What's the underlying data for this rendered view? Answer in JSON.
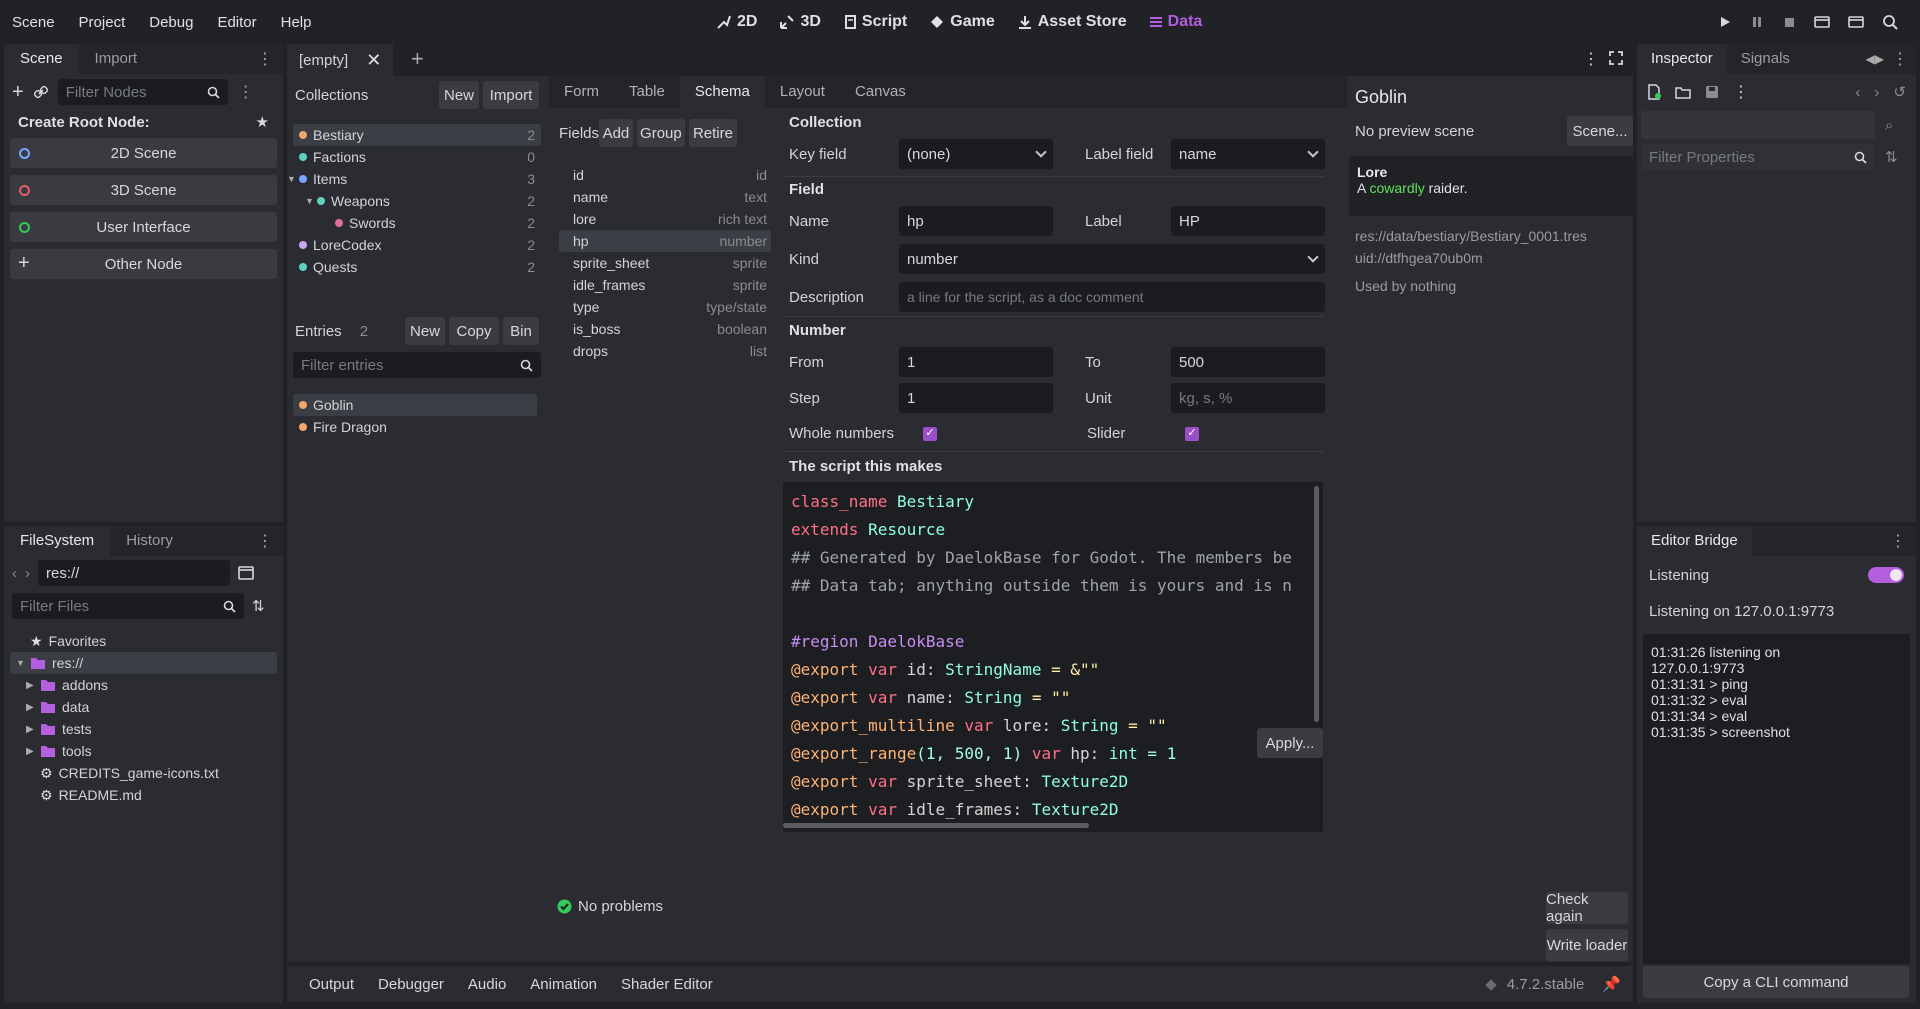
{
  "menu": [
    "Scene",
    "Project",
    "Debug",
    "Editor",
    "Help"
  ],
  "workspaces": [
    {
      "label": "2D",
      "icon": "2d-icon"
    },
    {
      "label": "3D",
      "icon": "3d-icon"
    },
    {
      "label": "Script",
      "icon": "script-icon"
    },
    {
      "label": "Game",
      "icon": "game-icon"
    },
    {
      "label": "Asset Store",
      "icon": "download-icon"
    },
    {
      "label": "Data",
      "icon": "list-icon",
      "active": true
    }
  ],
  "colors": {
    "accent": "#b45fe0",
    "green": "#35c85a",
    "blue": "#7aa7ff",
    "red": "#e35d6a",
    "teal": "#5fd1c3"
  },
  "scene_dock": {
    "tabs": [
      "Scene",
      "Import"
    ],
    "filter_placeholder": "Filter Nodes",
    "create_root": "Create Root Node:",
    "buttons": [
      {
        "label": "2D Scene",
        "color": "#7aa7ff"
      },
      {
        "label": "3D Scene",
        "color": "#e35d6a"
      },
      {
        "label": "User Interface",
        "color": "#35c85a"
      },
      {
        "label": "Other Node",
        "icon": "plus"
      }
    ]
  },
  "fs_dock": {
    "tabs": [
      "FileSystem",
      "History"
    ],
    "path": "res://",
    "filter_placeholder": "Filter Files",
    "tree": [
      {
        "label": "Favorites",
        "icon": "star-icon",
        "depth": 0
      },
      {
        "label": "res://",
        "icon": "folder-icon",
        "depth": 0,
        "open": true,
        "selected": true
      },
      {
        "label": "addons",
        "icon": "folder-icon",
        "depth": 1
      },
      {
        "label": "data",
        "icon": "folder-icon",
        "depth": 1
      },
      {
        "label": "tests",
        "icon": "folder-icon",
        "depth": 1
      },
      {
        "label": "tools",
        "icon": "folder-icon",
        "depth": 1
      },
      {
        "label": "CREDITS_game-icons.txt",
        "icon": "file-icon",
        "depth": 1
      },
      {
        "label": "README.md",
        "icon": "file-icon",
        "depth": 1
      }
    ]
  },
  "editor_tab": "[empty]",
  "collections": {
    "title": "Collections",
    "new": "New",
    "import": "Import",
    "items": [
      {
        "label": "Bestiary",
        "count": "2",
        "color": "#f2a76b",
        "depth": 0,
        "selected": true
      },
      {
        "label": "Factions",
        "count": "0",
        "color": "#5fd1c3",
        "depth": 0
      },
      {
        "label": "Items",
        "count": "3",
        "color": "#7aa7ff",
        "depth": 0,
        "arrow": true
      },
      {
        "label": "Weapons",
        "count": "2",
        "color": "#5fd1c3",
        "depth": 1,
        "arrow": true
      },
      {
        "label": "Swords",
        "count": "2",
        "color": "#e0709a",
        "depth": 2
      },
      {
        "label": "LoreCodex",
        "count": "2",
        "color": "#c9a6f2",
        "depth": 0
      },
      {
        "label": "Quests",
        "count": "2",
        "color": "#5fd1c3",
        "depth": 0
      }
    ]
  },
  "entries": {
    "title": "Entries",
    "count": "2",
    "new": "New",
    "copy": "Copy",
    "bin": "Bin",
    "filter_placeholder": "Filter entries",
    "items": [
      {
        "label": "Goblin",
        "selected": true
      },
      {
        "label": "Fire Dragon"
      }
    ]
  },
  "subtabs": [
    "Form",
    "Table",
    "Schema",
    "Layout",
    "Canvas"
  ],
  "fields": {
    "title": "Fields",
    "add": "Add",
    "group": "Group",
    "retire": "Retire",
    "items": [
      {
        "name": "id",
        "kind": "id"
      },
      {
        "name": "name",
        "kind": "text"
      },
      {
        "name": "lore",
        "kind": "rich text"
      },
      {
        "name": "hp",
        "kind": "number",
        "selected": true
      },
      {
        "name": "sprite_sheet",
        "kind": "sprite"
      },
      {
        "name": "idle_frames",
        "kind": "sprite"
      },
      {
        "name": "type",
        "kind": "type/state"
      },
      {
        "name": "is_boss",
        "kind": "boolean"
      },
      {
        "name": "drops",
        "kind": "list"
      }
    ]
  },
  "schema": {
    "collection_heading": "Collection",
    "key_field_label": "Key field",
    "key_field_value": "(none)",
    "label_field_label": "Label field",
    "label_field_value": "name",
    "field_heading": "Field",
    "name_label": "Name",
    "name_value": "hp",
    "label_label": "Label",
    "label_value": "HP",
    "kind_label": "Kind",
    "kind_value": "number",
    "desc_label": "Description",
    "desc_placeholder": "a line for the script, as a doc comment",
    "number_heading": "Number",
    "from_label": "From",
    "from_value": "1",
    "to_label": "To",
    "to_value": "500",
    "step_label": "Step",
    "step_value": "1",
    "unit_label": "Unit",
    "unit_placeholder": "kg, s, %",
    "whole_label": "Whole numbers",
    "slider_label": "Slider",
    "script_heading": "The script this makes",
    "apply": "Apply..."
  },
  "code_lines": [
    [
      [
        "class_name ",
        "#ff7085"
      ],
      [
        "Bestiary",
        "#8fffdb"
      ]
    ],
    [
      [
        "extends ",
        "#ff7085"
      ],
      [
        "Resource",
        "#8fffdb"
      ]
    ],
    [
      [
        "## Generated by DaelokBase for Godot. The members be",
        "#a0a3a8"
      ]
    ],
    [
      [
        "## Data tab; anything outside them is yours and is n",
        "#a0a3a8"
      ]
    ],
    [],
    [
      [
        "#region DaelokBase",
        "#c98cf0"
      ]
    ],
    [
      [
        "@export ",
        "#ffb373"
      ],
      [
        "var ",
        "#ff7085"
      ],
      [
        "id: ",
        "#d5d5d5"
      ],
      [
        "StringName",
        "#8fffdb"
      ],
      [
        " = &\"\"",
        "#ffeda1"
      ]
    ],
    [
      [
        "@export ",
        "#ffb373"
      ],
      [
        "var ",
        "#ff7085"
      ],
      [
        "name: ",
        "#d5d5d5"
      ],
      [
        "String",
        "#8fffdb"
      ],
      [
        " = \"\"",
        "#ffeda1"
      ]
    ],
    [
      [
        "@export_multiline ",
        "#ffb373"
      ],
      [
        "var ",
        "#ff7085"
      ],
      [
        "lore: ",
        "#d5d5d5"
      ],
      [
        "String",
        "#8fffdb"
      ],
      [
        " = \"\"",
        "#ffeda1"
      ]
    ],
    [
      [
        "@export_range",
        "#ffb373"
      ],
      [
        "(1, 500, 1) ",
        "#a1ffe0"
      ],
      [
        "var ",
        "#ff7085"
      ],
      [
        "hp: ",
        "#d5d5d5"
      ],
      [
        "int",
        "#8fffdb"
      ],
      [
        " = 1",
        "#a1ffe0"
      ]
    ],
    [
      [
        "@export ",
        "#ffb373"
      ],
      [
        "var ",
        "#ff7085"
      ],
      [
        "sprite_sheet: ",
        "#d5d5d5"
      ],
      [
        "Texture2D",
        "#8fffdb"
      ]
    ],
    [
      [
        "@export ",
        "#ffb373"
      ],
      [
        "var ",
        "#ff7085"
      ],
      [
        "idle_frames: ",
        "#d5d5d5"
      ],
      [
        "Texture2D",
        "#8fffdb"
      ]
    ]
  ],
  "status": {
    "no_problems": "No problems",
    "check_again": "Check again",
    "write_loader": "Write loader"
  },
  "preview": {
    "title": "Goblin",
    "no_preview": "No preview scene",
    "scene_btn": "Scene...",
    "lore_label": "Lore",
    "lore_pre": "A ",
    "lore_hi": "cowardly",
    "lore_post": " raider.",
    "path": "res://data/bestiary/Bestiary_0001.tres",
    "uid": "uid://dtfhgea70ub0m",
    "used_by": "Used by nothing"
  },
  "inspector": {
    "tabs": [
      "Inspector",
      "Signals"
    ],
    "filter_placeholder": "Filter Properties"
  },
  "bridge": {
    "title": "Editor Bridge",
    "listening_label": "Listening",
    "listening_on": "Listening on 127.0.0.1:9773",
    "log": [
      "01:31:26  listening on",
      "127.0.0.1:9773",
      "01:31:31  > ping",
      "01:31:32  > eval",
      "01:31:34  > eval",
      "01:31:35  > screenshot"
    ],
    "copy_cli": "Copy a CLI command"
  },
  "bottom_tabs": [
    "Output",
    "Debugger",
    "Audio",
    "Animation",
    "Shader Editor"
  ],
  "version": "4.7.2.stable"
}
